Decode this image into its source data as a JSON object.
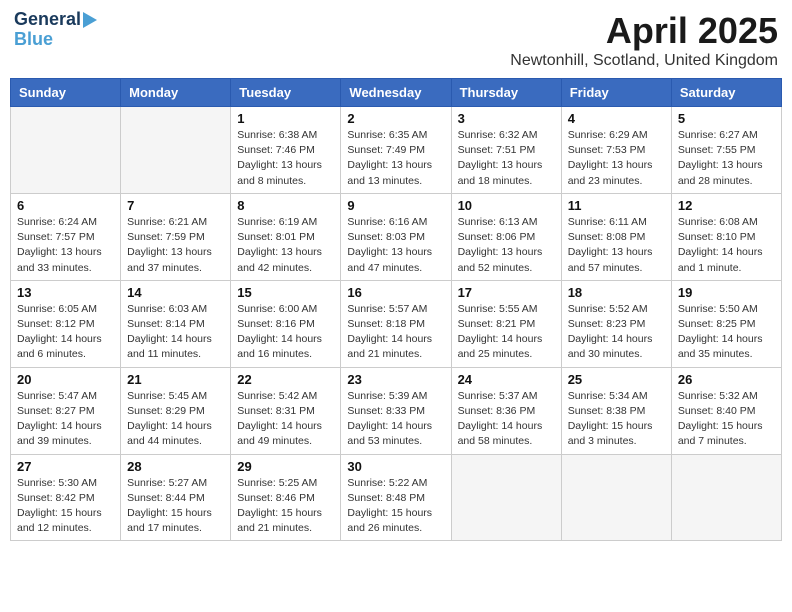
{
  "logo": {
    "line1": "General",
    "line2": "Blue"
  },
  "title": "April 2025",
  "location": "Newtonhill, Scotland, United Kingdom",
  "weekdays": [
    "Sunday",
    "Monday",
    "Tuesday",
    "Wednesday",
    "Thursday",
    "Friday",
    "Saturday"
  ],
  "weeks": [
    [
      {
        "day": "",
        "info": ""
      },
      {
        "day": "",
        "info": ""
      },
      {
        "day": "1",
        "info": "Sunrise: 6:38 AM\nSunset: 7:46 PM\nDaylight: 13 hours and 8 minutes."
      },
      {
        "day": "2",
        "info": "Sunrise: 6:35 AM\nSunset: 7:49 PM\nDaylight: 13 hours and 13 minutes."
      },
      {
        "day": "3",
        "info": "Sunrise: 6:32 AM\nSunset: 7:51 PM\nDaylight: 13 hours and 18 minutes."
      },
      {
        "day": "4",
        "info": "Sunrise: 6:29 AM\nSunset: 7:53 PM\nDaylight: 13 hours and 23 minutes."
      },
      {
        "day": "5",
        "info": "Sunrise: 6:27 AM\nSunset: 7:55 PM\nDaylight: 13 hours and 28 minutes."
      }
    ],
    [
      {
        "day": "6",
        "info": "Sunrise: 6:24 AM\nSunset: 7:57 PM\nDaylight: 13 hours and 33 minutes."
      },
      {
        "day": "7",
        "info": "Sunrise: 6:21 AM\nSunset: 7:59 PM\nDaylight: 13 hours and 37 minutes."
      },
      {
        "day": "8",
        "info": "Sunrise: 6:19 AM\nSunset: 8:01 PM\nDaylight: 13 hours and 42 minutes."
      },
      {
        "day": "9",
        "info": "Sunrise: 6:16 AM\nSunset: 8:03 PM\nDaylight: 13 hours and 47 minutes."
      },
      {
        "day": "10",
        "info": "Sunrise: 6:13 AM\nSunset: 8:06 PM\nDaylight: 13 hours and 52 minutes."
      },
      {
        "day": "11",
        "info": "Sunrise: 6:11 AM\nSunset: 8:08 PM\nDaylight: 13 hours and 57 minutes."
      },
      {
        "day": "12",
        "info": "Sunrise: 6:08 AM\nSunset: 8:10 PM\nDaylight: 14 hours and 1 minute."
      }
    ],
    [
      {
        "day": "13",
        "info": "Sunrise: 6:05 AM\nSunset: 8:12 PM\nDaylight: 14 hours and 6 minutes."
      },
      {
        "day": "14",
        "info": "Sunrise: 6:03 AM\nSunset: 8:14 PM\nDaylight: 14 hours and 11 minutes."
      },
      {
        "day": "15",
        "info": "Sunrise: 6:00 AM\nSunset: 8:16 PM\nDaylight: 14 hours and 16 minutes."
      },
      {
        "day": "16",
        "info": "Sunrise: 5:57 AM\nSunset: 8:18 PM\nDaylight: 14 hours and 21 minutes."
      },
      {
        "day": "17",
        "info": "Sunrise: 5:55 AM\nSunset: 8:21 PM\nDaylight: 14 hours and 25 minutes."
      },
      {
        "day": "18",
        "info": "Sunrise: 5:52 AM\nSunset: 8:23 PM\nDaylight: 14 hours and 30 minutes."
      },
      {
        "day": "19",
        "info": "Sunrise: 5:50 AM\nSunset: 8:25 PM\nDaylight: 14 hours and 35 minutes."
      }
    ],
    [
      {
        "day": "20",
        "info": "Sunrise: 5:47 AM\nSunset: 8:27 PM\nDaylight: 14 hours and 39 minutes."
      },
      {
        "day": "21",
        "info": "Sunrise: 5:45 AM\nSunset: 8:29 PM\nDaylight: 14 hours and 44 minutes."
      },
      {
        "day": "22",
        "info": "Sunrise: 5:42 AM\nSunset: 8:31 PM\nDaylight: 14 hours and 49 minutes."
      },
      {
        "day": "23",
        "info": "Sunrise: 5:39 AM\nSunset: 8:33 PM\nDaylight: 14 hours and 53 minutes."
      },
      {
        "day": "24",
        "info": "Sunrise: 5:37 AM\nSunset: 8:36 PM\nDaylight: 14 hours and 58 minutes."
      },
      {
        "day": "25",
        "info": "Sunrise: 5:34 AM\nSunset: 8:38 PM\nDaylight: 15 hours and 3 minutes."
      },
      {
        "day": "26",
        "info": "Sunrise: 5:32 AM\nSunset: 8:40 PM\nDaylight: 15 hours and 7 minutes."
      }
    ],
    [
      {
        "day": "27",
        "info": "Sunrise: 5:30 AM\nSunset: 8:42 PM\nDaylight: 15 hours and 12 minutes."
      },
      {
        "day": "28",
        "info": "Sunrise: 5:27 AM\nSunset: 8:44 PM\nDaylight: 15 hours and 17 minutes."
      },
      {
        "day": "29",
        "info": "Sunrise: 5:25 AM\nSunset: 8:46 PM\nDaylight: 15 hours and 21 minutes."
      },
      {
        "day": "30",
        "info": "Sunrise: 5:22 AM\nSunset: 8:48 PM\nDaylight: 15 hours and 26 minutes."
      },
      {
        "day": "",
        "info": ""
      },
      {
        "day": "",
        "info": ""
      },
      {
        "day": "",
        "info": ""
      }
    ]
  ]
}
